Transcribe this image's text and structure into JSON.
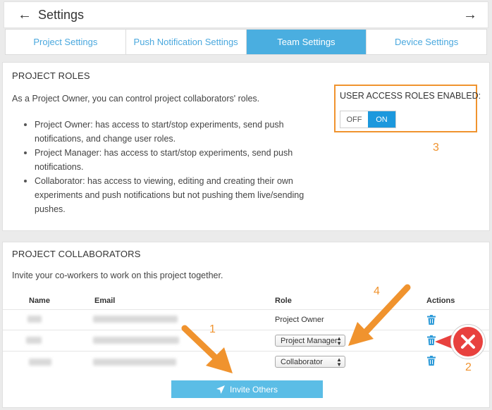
{
  "header": {
    "title": "Settings"
  },
  "tabs": [
    {
      "label": "Project Settings",
      "active": false
    },
    {
      "label": "Push Notification Settings",
      "active": false
    },
    {
      "label": "Team Settings",
      "active": true
    },
    {
      "label": "Device Settings",
      "active": false
    }
  ],
  "roles": {
    "title": "PROJECT ROLES",
    "intro": "As a Project Owner, you can control project collaborators' roles.",
    "items": [
      "Project Owner: has access to start/stop experiments, send push notifications, and change user roles.",
      "Project Manager: has access to start/stop experiments, send push notifications.",
      "Collaborator: has access to viewing, editing and creating their own experiments and push notifications but not pushing them live/sending pushes."
    ],
    "access_label": "USER ACCESS ROLES ENABLED:",
    "toggle": {
      "off": "OFF",
      "on": "ON",
      "selected": "ON"
    }
  },
  "collaborators": {
    "title": "PROJECT COLLABORATORS",
    "intro": "Invite your co-workers to work on this project together.",
    "columns": {
      "name": "Name",
      "email": "Email",
      "role": "Role",
      "actions": "Actions"
    },
    "rows": [
      {
        "role": "Project Owner"
      },
      {
        "role": "Project Manager"
      },
      {
        "role": "Collaborator"
      }
    ],
    "invite_label": "Invite Others"
  },
  "annotations": {
    "n1": "1",
    "n2": "2",
    "n3": "3",
    "n4": "4"
  },
  "colors": {
    "accent": "#4aaee0",
    "toggle_on": "#1c98dd",
    "annotation": "#f0932e",
    "remove_badge": "#e8413e"
  }
}
